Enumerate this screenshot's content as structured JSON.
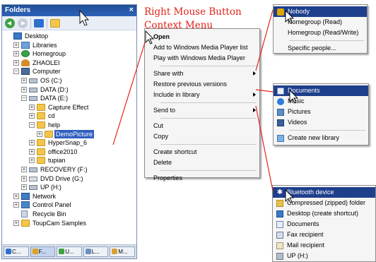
{
  "folders_pane": {
    "title": "Folders",
    "close_glyph": "×",
    "tree": [
      {
        "id": "desktop",
        "label": "Desktop",
        "icon": "desktop-icon",
        "expander": "",
        "x": 0,
        "y": 0
      },
      {
        "id": "libraries",
        "label": "Libraries",
        "icon": "libraries-icon",
        "expander": "+",
        "x": 1,
        "y": 1
      },
      {
        "id": "homegroup",
        "label": "Homegroup",
        "icon": "homegroup-icon",
        "expander": "+",
        "x": 1,
        "y": 2
      },
      {
        "id": "zhaolei",
        "label": "ZHAOLEI",
        "icon": "user-folder-icon",
        "expander": "+",
        "x": 1,
        "y": 3
      },
      {
        "id": "computer",
        "label": "Computer",
        "icon": "computer-icon",
        "expander": "−",
        "x": 1,
        "y": 4
      },
      {
        "id": "os",
        "label": "OS (C:)",
        "icon": "drive-icon",
        "expander": "+",
        "x": 2,
        "y": 5
      },
      {
        "id": "data-d",
        "label": "DATA (D:)",
        "icon": "drive-icon",
        "expander": "+",
        "x": 2,
        "y": 6
      },
      {
        "id": "data-e",
        "label": "DATA (E:)",
        "icon": "drive-icon",
        "expander": "−",
        "x": 2,
        "y": 7
      },
      {
        "id": "capture",
        "label": "Capture Effect",
        "icon": "folder-icon",
        "expander": "+",
        "x": 3,
        "y": 8
      },
      {
        "id": "cd",
        "label": "cd",
        "icon": "folder-icon",
        "expander": "+",
        "x": 3,
        "y": 9
      },
      {
        "id": "help",
        "label": "help",
        "icon": "folder-icon",
        "expander": "−",
        "x": 3,
        "y": 10
      },
      {
        "id": "demopicture",
        "label": "DemoPicture",
        "icon": "folder-icon",
        "expander": "+",
        "x": 4,
        "y": 11,
        "selected": true
      },
      {
        "id": "hypersnap",
        "label": "HyperSnap_6",
        "icon": "folder-icon",
        "expander": "+",
        "x": 3,
        "y": 12
      },
      {
        "id": "office",
        "label": "office2010",
        "icon": "folder-icon",
        "expander": "+",
        "x": 3,
        "y": 13
      },
      {
        "id": "tupian",
        "label": "tupian",
        "icon": "folder-icon",
        "expander": "+",
        "x": 3,
        "y": 14
      },
      {
        "id": "recovery",
        "label": "RECOVERY (F:)",
        "icon": "drive-icon",
        "expander": "+",
        "x": 2,
        "y": 15
      },
      {
        "id": "dvd",
        "label": "DVD Drive (G:)",
        "icon": "dvd-icon",
        "expander": "+",
        "x": 2,
        "y": 16
      },
      {
        "id": "up",
        "label": "UP (H:)",
        "icon": "drive-icon",
        "expander": "+",
        "x": 2,
        "y": 17
      },
      {
        "id": "network",
        "label": "Network",
        "icon": "network-icon",
        "expander": "+",
        "x": 1,
        "y": 18
      },
      {
        "id": "controlpanel",
        "label": "Control Panel",
        "icon": "control-panel-icon",
        "expander": "+",
        "x": 1,
        "y": 19
      },
      {
        "id": "recyclebin",
        "label": "Recycle Bin",
        "icon": "recycle-bin-icon",
        "expander": "",
        "x": 1,
        "y": 20
      },
      {
        "id": "toupcam",
        "label": "ToupCam Samples",
        "icon": "folder-icon",
        "expander": "+",
        "x": 1,
        "y": 21
      }
    ],
    "taskbar": [
      {
        "label": "C...",
        "color": "#2f6fd0"
      },
      {
        "label": "F...",
        "color": "#e0a020",
        "active": true
      },
      {
        "label": "U...",
        "color": "#3fa142"
      },
      {
        "label": "L...",
        "color": "#6a8fc0"
      },
      {
        "label": "M...",
        "color": "#d8a030"
      }
    ]
  },
  "annotation": {
    "line1": "Right Mouse Button",
    "line2": "Context Menu"
  },
  "context_menu": {
    "groups": [
      [
        {
          "label": "Open",
          "bold": true
        },
        {
          "label": "Add to Windows Media Player list"
        },
        {
          "label": "Play with Windows Media Player"
        }
      ],
      [
        {
          "label": "Share with",
          "submenu": true
        },
        {
          "label": "Restore previous versions"
        },
        {
          "label": "Include in library",
          "submenu": true
        }
      ],
      [
        {
          "label": "Send to",
          "submenu": true
        }
      ],
      [
        {
          "label": "Cut"
        },
        {
          "label": "Copy"
        }
      ],
      [
        {
          "label": "Create shortcut"
        },
        {
          "label": "Delete"
        }
      ],
      [
        {
          "label": "Properties"
        }
      ]
    ]
  },
  "share_with_menu": {
    "items": [
      {
        "label": "Nobody",
        "icon": "lock-icon",
        "highlighted": true
      },
      {
        "label": "Homegroup (Read)"
      },
      {
        "label": "Homegroup (Read/Write)"
      },
      {
        "sep": true
      },
      {
        "label": "Specific people..."
      }
    ]
  },
  "include_library_menu": {
    "items": [
      {
        "label": "Documents",
        "icon": "documents-icon",
        "highlighted": true
      },
      {
        "label": "Music",
        "icon": "music-icon"
      },
      {
        "label": "Pictures",
        "icon": "pictures-icon"
      },
      {
        "label": "Videos",
        "icon": "videos-icon"
      },
      {
        "sep": true
      },
      {
        "label": "Create new library",
        "icon": "new-library-icon"
      }
    ]
  },
  "send_to_menu": {
    "items": [
      {
        "label": "Bluetooth device",
        "icon": "bluetooth-icon",
        "highlighted": true
      },
      {
        "label": "Compressed (zipped) folder",
        "icon": "zip-folder-icon"
      },
      {
        "label": "Desktop (create shortcut)",
        "icon": "desktop-shortcut-icon"
      },
      {
        "label": "Documents",
        "icon": "documents-icon"
      },
      {
        "label": "Fax recipient",
        "icon": "fax-icon"
      },
      {
        "label": "Mail recipient",
        "icon": "mail-icon"
      },
      {
        "label": "UP (H:)",
        "icon": "drive-icon"
      }
    ]
  },
  "colors": {
    "annotation": "#e2231a",
    "selection": "#2f5fc0",
    "submenu_highlight": "#1e3f8c"
  }
}
